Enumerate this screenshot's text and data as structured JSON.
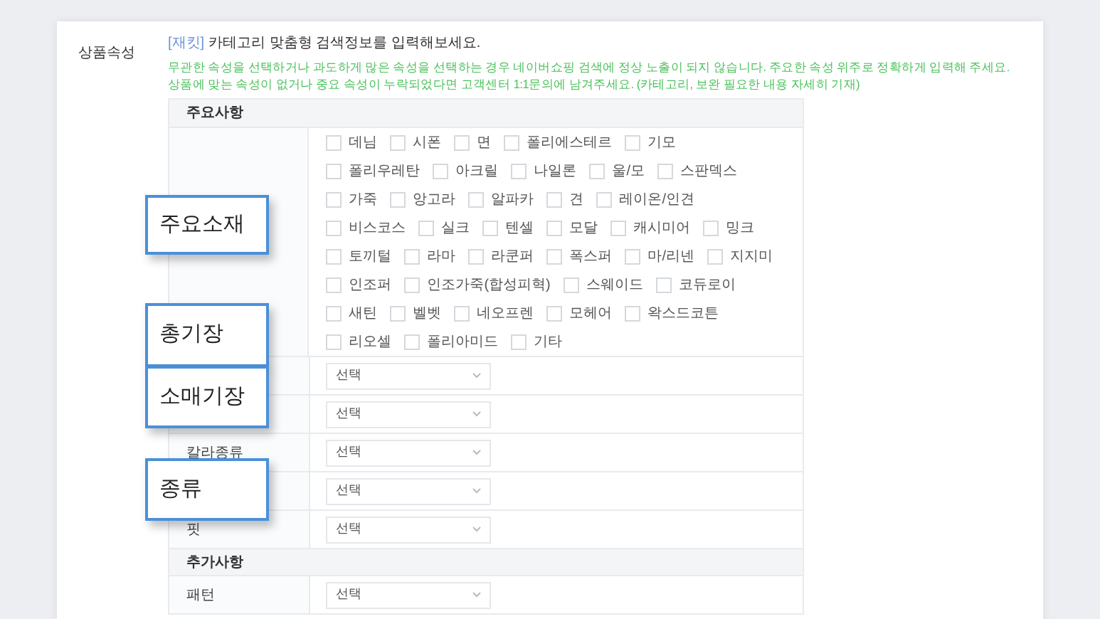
{
  "section_label": "상품속성",
  "intro": {
    "tag": "[재킷]",
    "text": "카테고리 맞춤형 검색정보를 입력해보세요."
  },
  "notices": [
    "무관한 속성을 선택하거나 과도하게 많은 속성을 선택하는 경우 네이버쇼핑 검색에 정상 노출이 되지 않습니다. 주요한 속성 위주로 정확하게 입력해 주세요.",
    "상품에 맞는 속성이 없거나 중요 속성이 누락되었다면 고객센터 1:1문의에 남겨주세요. (카테고리, 보완 필요한 내용 자세히 기재)"
  ],
  "groups": [
    {
      "title": "주요사항",
      "rows": [
        {
          "kind": "checkboxes",
          "options": [
            [
              {
                "label": "데님",
                "checked": false
              },
              {
                "label": "시폰",
                "checked": false
              },
              {
                "label": "면",
                "checked": false
              },
              {
                "label": "폴리에스테르",
                "checked": false
              },
              {
                "label": "기모",
                "checked": false
              }
            ],
            [
              {
                "label": "폴리우레탄",
                "checked": false
              },
              {
                "label": "아크릴",
                "checked": false
              },
              {
                "label": "나일론",
                "checked": false
              },
              {
                "label": "울/모",
                "checked": false
              },
              {
                "label": "스판덱스",
                "checked": false
              }
            ],
            [
              {
                "label": "가죽",
                "checked": false
              },
              {
                "label": "앙고라",
                "checked": false
              },
              {
                "label": "알파카",
                "checked": false
              },
              {
                "label": "견",
                "checked": false
              },
              {
                "label": "레이온/인견",
                "checked": false
              }
            ],
            [
              {
                "label": "비스코스",
                "checked": false
              },
              {
                "label": "실크",
                "checked": false
              },
              {
                "label": "텐셀",
                "checked": false
              },
              {
                "label": "모달",
                "checked": false
              },
              {
                "label": "캐시미어",
                "checked": false
              },
              {
                "label": "밍크",
                "checked": false
              }
            ],
            [
              {
                "label": "토끼털",
                "checked": false
              },
              {
                "label": "라마",
                "checked": false
              },
              {
                "label": "라쿤퍼",
                "checked": false
              },
              {
                "label": "폭스퍼",
                "checked": false
              },
              {
                "label": "마/리넨",
                "checked": false
              },
              {
                "label": "지지미",
                "checked": false
              }
            ],
            [
              {
                "label": "인조퍼",
                "checked": false
              },
              {
                "label": "인조가죽(합성피혁)",
                "checked": false
              },
              {
                "label": "스웨이드",
                "checked": false
              },
              {
                "label": "코듀로이",
                "checked": false
              }
            ],
            [
              {
                "label": "새틴",
                "checked": false
              },
              {
                "label": "벨벳",
                "checked": false
              },
              {
                "label": "네오프렌",
                "checked": false
              },
              {
                "label": "모헤어",
                "checked": false
              },
              {
                "label": "왁스드코튼",
                "checked": false
              }
            ],
            [
              {
                "label": "리오셀",
                "checked": false
              },
              {
                "label": "폴리아미드",
                "checked": false
              },
              {
                "label": "기타",
                "checked": false
              }
            ]
          ]
        },
        {
          "kind": "select",
          "value": "선택"
        },
        {
          "kind": "select",
          "value": "선택"
        },
        {
          "kind": "select",
          "label": "칼라종류",
          "value": "선택"
        },
        {
          "kind": "select",
          "value": "선택"
        },
        {
          "kind": "select",
          "label": "핏",
          "value": "선택"
        }
      ]
    },
    {
      "title": "추가사항",
      "rows": [
        {
          "kind": "select",
          "label": "패턴",
          "value": "선택"
        }
      ]
    }
  ],
  "callouts": [
    "주요소재",
    "총기장",
    "소매기장",
    "종류"
  ]
}
